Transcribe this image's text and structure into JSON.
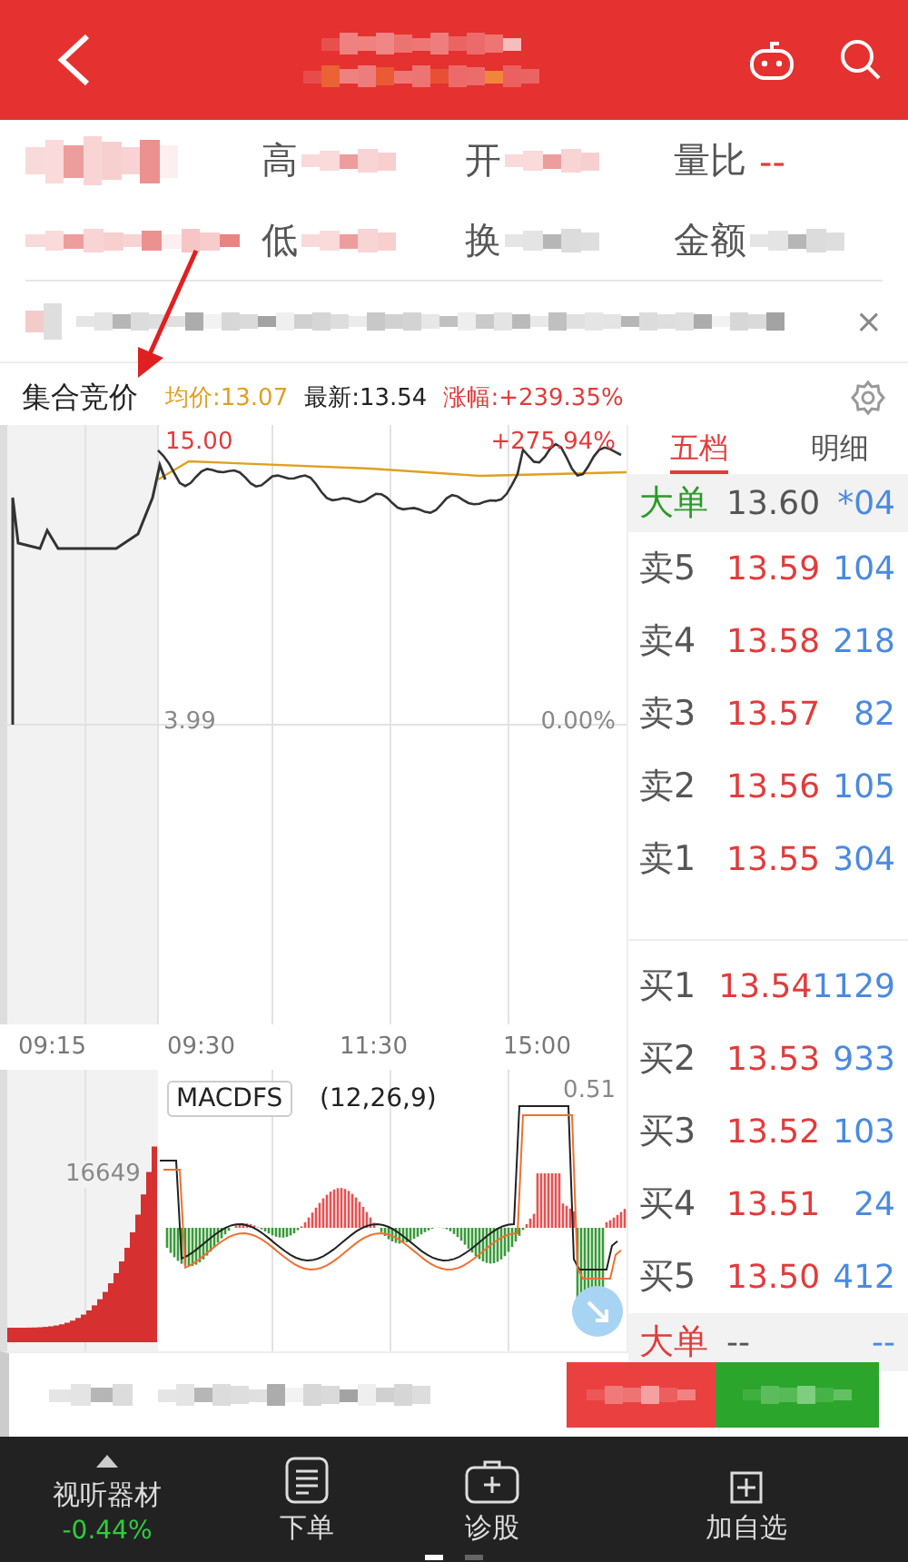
{
  "quote": {
    "fields": [
      {
        "label": "高"
      },
      {
        "label": "开"
      },
      {
        "label": "低"
      },
      {
        "label": "换"
      },
      {
        "label": "金额"
      }
    ],
    "volume_ratio": {
      "label": "量比",
      "value": "--"
    }
  },
  "news": {
    "close": "×"
  },
  "intraday": {
    "title": "集合竞价",
    "average": "均价:13.07",
    "latest": "最新:13.54",
    "change": "涨幅:+239.35%"
  },
  "chart": {
    "high": "15.00",
    "high_pct": "+275.94%",
    "base": "3.99",
    "base_pct": "0.00%",
    "times": [
      "09:15",
      "09:30",
      "11:30",
      "15:00"
    ]
  },
  "macd": {
    "name": "MACDFS",
    "params": "(12,26,9)",
    "peak": "0.51",
    "volume": "16649"
  },
  "order_book": {
    "tabs": [
      {
        "label": "五档",
        "selected": true
      },
      {
        "label": "明细",
        "selected": false
      }
    ],
    "rows": [
      {
        "kind": "big",
        "label": "大单",
        "price": "13.60",
        "volume": "*04",
        "color": "#2a9a2a"
      },
      {
        "kind": "level",
        "label": "卖5",
        "price": "13.59",
        "volume": "104"
      },
      {
        "kind": "level",
        "label": "卖4",
        "price": "13.58",
        "volume": "218"
      },
      {
        "kind": "level",
        "label": "卖3",
        "price": "13.57",
        "volume": "82"
      },
      {
        "kind": "level",
        "label": "卖2",
        "price": "13.56",
        "volume": "105"
      },
      {
        "kind": "level",
        "label": "卖1",
        "price": "13.55",
        "volume": "304"
      },
      {
        "kind": "gap"
      },
      {
        "kind": "level",
        "label": "买1",
        "price": "13.54",
        "volume": "1129"
      },
      {
        "kind": "level",
        "label": "买2",
        "price": "13.53",
        "volume": "933"
      },
      {
        "kind": "level",
        "label": "买3",
        "price": "13.52",
        "volume": "103"
      },
      {
        "kind": "level",
        "label": "买4",
        "price": "13.51",
        "volume": "24"
      },
      {
        "kind": "level",
        "label": "买5",
        "price": "13.50",
        "volume": "412"
      },
      {
        "kind": "big",
        "label": "大单",
        "price": "--",
        "volume": "--",
        "color": "#e23b3b"
      }
    ]
  },
  "nav": {
    "items": [
      {
        "kind": "sector",
        "label": "视听器材",
        "value": "-0.44%"
      },
      {
        "kind": "order",
        "label": "下单"
      },
      {
        "kind": "diagnose",
        "label": "诊股"
      },
      {
        "kind": "add",
        "label": "加自选"
      }
    ],
    "pages": [
      {
        "selected": true
      },
      {
        "selected": false
      }
    ]
  }
}
